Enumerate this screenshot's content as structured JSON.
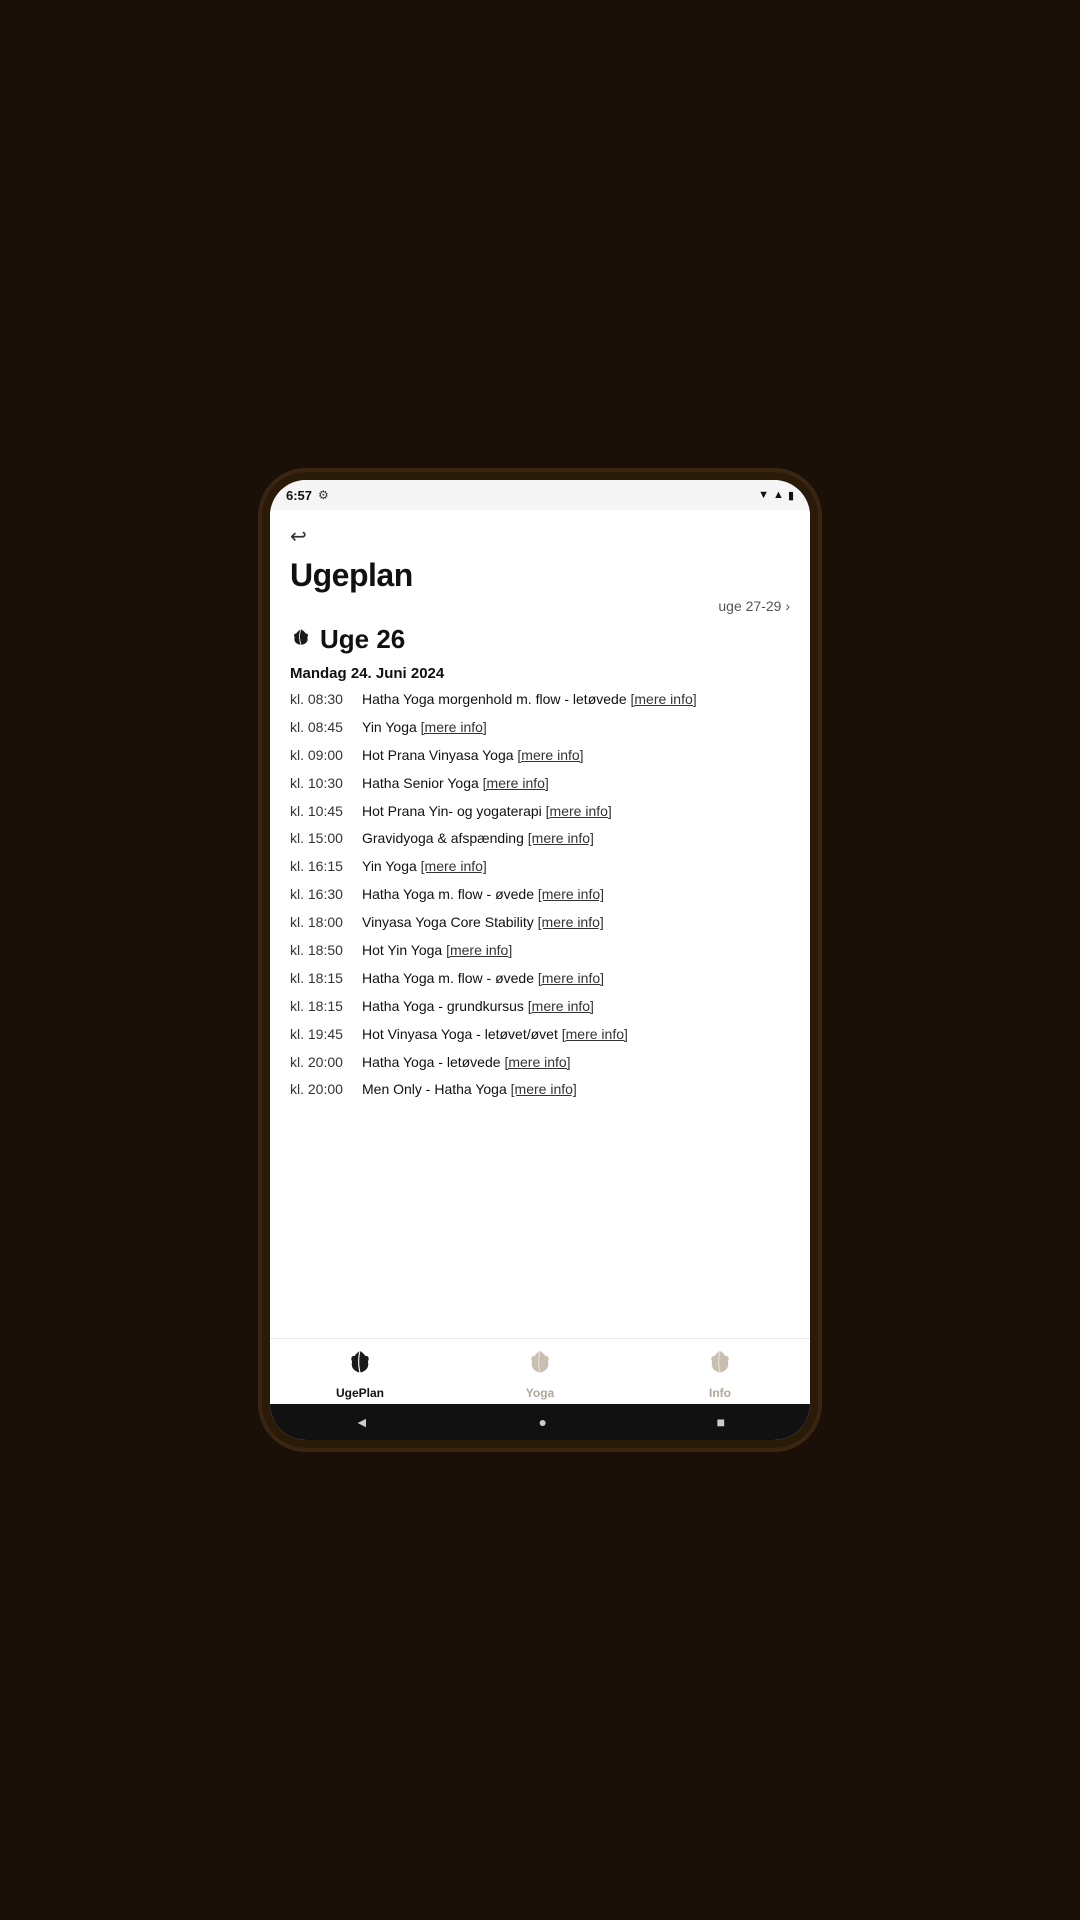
{
  "statusBar": {
    "time": "6:57",
    "icons": [
      "gear",
      "wifi",
      "signal",
      "battery"
    ]
  },
  "header": {
    "backLabel": "←",
    "title": "Ugeplan",
    "weekNav": "uge 27-29 ›"
  },
  "weekSection": {
    "weekLabel": "Uge 26",
    "day": {
      "label": "Mandag 24. Juni 2024",
      "classes": [
        {
          "time": "kl. 08:30",
          "name": "Hatha Yoga morgenhold m. flow - letøvede",
          "link": "[mere info]"
        },
        {
          "time": "kl. 08:45",
          "name": "Yin Yoga",
          "link": "[mere info]"
        },
        {
          "time": "kl. 09:00",
          "name": "Hot Prana Vinyasa Yoga",
          "link": "[mere info]"
        },
        {
          "time": "kl. 10:30",
          "name": "Hatha Senior Yoga",
          "link": "[mere info]"
        },
        {
          "time": "kl. 10:45",
          "name": "Hot Prana Yin- og yogaterapi",
          "link": "[mere info]"
        },
        {
          "time": "kl. 15:00",
          "name": "Gravidyoga & afspænding",
          "link": "[mere info]"
        },
        {
          "time": "kl. 16:15",
          "name": "Yin Yoga",
          "link": "[mere info]"
        },
        {
          "time": "kl. 16:30",
          "name": "Hatha Yoga m. flow - øvede",
          "link": "[mere info]"
        },
        {
          "time": "kl. 18:00",
          "name": "Vinyasa Yoga Core Stability",
          "link": "[mere info]"
        },
        {
          "time": "kl. 18:50",
          "name": "Hot Yin Yoga",
          "link": "[mere info]"
        },
        {
          "time": "kl. 18:15",
          "name": "Hatha Yoga m. flow - øvede",
          "link": "[mere info]"
        },
        {
          "time": "kl. 18:15",
          "name": "Hatha Yoga - grundkursus",
          "link": "[mere info]"
        },
        {
          "time": "kl. 19:45",
          "name": "Hot Vinyasa Yoga - letøvet/øvet",
          "link": "[mere info]"
        },
        {
          "time": "kl. 20:00",
          "name": "Hatha Yoga - letøvede",
          "link": "[mere info]"
        },
        {
          "time": "kl. 20:00",
          "name": "Men Only - Hatha Yoga",
          "link": "[mere info]"
        }
      ]
    }
  },
  "bottomNav": {
    "items": [
      {
        "id": "ugeplan",
        "label": "UgePlan",
        "active": true
      },
      {
        "id": "yoga",
        "label": "Yoga",
        "active": false
      },
      {
        "id": "info",
        "label": "Info",
        "active": false
      }
    ]
  },
  "androidNav": {
    "back": "◄",
    "home": "●",
    "recent": "■"
  }
}
